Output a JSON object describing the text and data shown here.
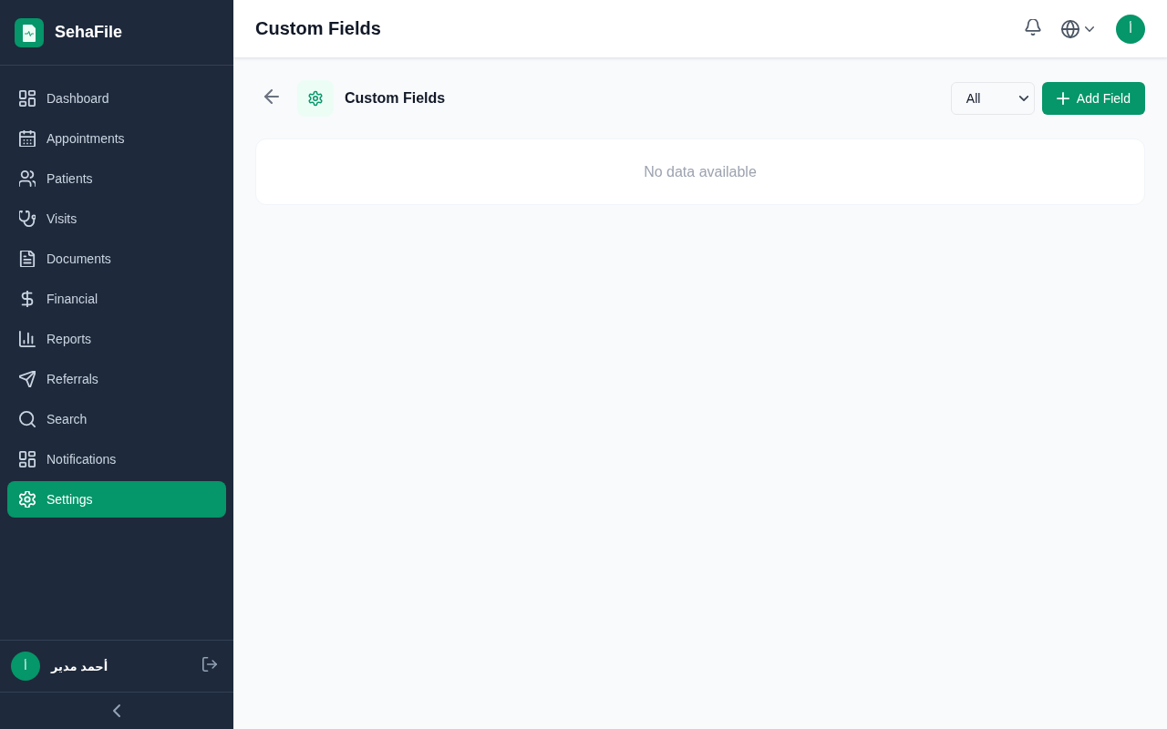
{
  "brand": {
    "name": "SehaFile"
  },
  "sidebar": {
    "items": [
      {
        "label": "Dashboard",
        "selected": false
      },
      {
        "label": "Appointments",
        "selected": false
      },
      {
        "label": "Patients",
        "selected": false
      },
      {
        "label": "Visits",
        "selected": false
      },
      {
        "label": "Documents",
        "selected": false
      },
      {
        "label": "Financial",
        "selected": false
      },
      {
        "label": "Reports",
        "selected": false
      },
      {
        "label": "Referrals",
        "selected": false
      },
      {
        "label": "Search",
        "selected": false
      },
      {
        "label": "Notifications",
        "selected": false
      },
      {
        "label": "Settings",
        "selected": true
      }
    ],
    "user": {
      "initial": "أ",
      "name": "أحمد مدير"
    }
  },
  "header": {
    "title": "Custom Fields",
    "avatar_initial": "أ"
  },
  "page": {
    "title": "Custom Fields",
    "filter": {
      "value": "All"
    },
    "add_button": "Add Field",
    "empty_message": "No data available"
  }
}
